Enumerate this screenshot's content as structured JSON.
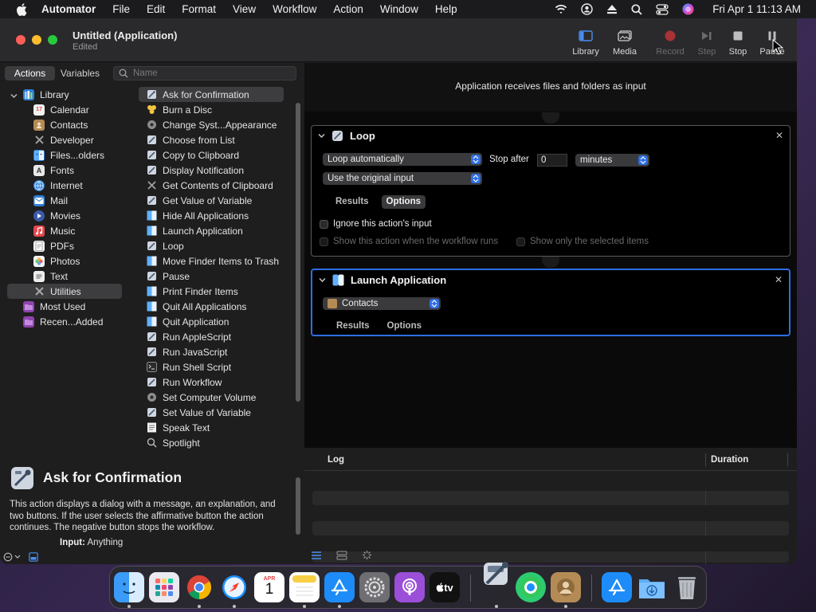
{
  "menubar": {
    "app": "Automator",
    "items": [
      "File",
      "Edit",
      "Format",
      "View",
      "Workflow",
      "Action",
      "Window",
      "Help"
    ],
    "clock": "Fri Apr 1  11:13 AM"
  },
  "window": {
    "title": "Untitled (Application)",
    "subtitle": "Edited",
    "toolbar": {
      "library": "Library",
      "media": "Media",
      "record": "Record",
      "step": "Step",
      "stop": "Stop",
      "pause": "Pause"
    }
  },
  "left": {
    "seg": {
      "actions": "Actions",
      "variables": "Variables"
    },
    "search_placeholder": "Name",
    "library": [
      {
        "label": "Library",
        "icon": "library-icon",
        "color": "#3d8bd9"
      },
      {
        "label": "Calendar",
        "icon": "calendar-icon",
        "color": "#e9e9e9"
      },
      {
        "label": "Contacts",
        "icon": "contacts-icon",
        "color": "#b58b55"
      },
      {
        "label": "Developer",
        "icon": "developer-icon",
        "color": "#8a8a8a"
      },
      {
        "label": "Files...olders",
        "icon": "finder-icon",
        "color": "#3d8bd9"
      },
      {
        "label": "Fonts",
        "icon": "fonts-icon",
        "color": "#cfcfcf"
      },
      {
        "label": "Internet",
        "icon": "internet-icon",
        "color": "#3d8bd9"
      },
      {
        "label": "Mail",
        "icon": "mail-icon",
        "color": "#3d8bd9"
      },
      {
        "label": "Movies",
        "icon": "movies-icon",
        "color": "#4b6cb7"
      },
      {
        "label": "Music",
        "icon": "music-icon",
        "color": "#e5484d"
      },
      {
        "label": "PDFs",
        "icon": "pdf-icon",
        "color": "#d9d9d9"
      },
      {
        "label": "Photos",
        "icon": "photos-icon",
        "color": "#e7a33a"
      },
      {
        "label": "Text",
        "icon": "text-icon",
        "color": "#cfcfcf"
      },
      {
        "label": "Utilities",
        "icon": "utilities-icon",
        "color": "#8a8a8a"
      },
      {
        "label": "Most Used",
        "icon": "most-used-icon",
        "color": "#9b59b6"
      },
      {
        "label": "Recen...Added",
        "icon": "recently-added-icon",
        "color": "#9b59b6"
      }
    ],
    "actions": [
      "Ask for Confirmation",
      "Burn a Disc",
      "Change Syst...Appearance",
      "Choose from List",
      "Copy to Clipboard",
      "Display Notification",
      "Get Contents of Clipboard",
      "Get Value of Variable",
      "Hide All Applications",
      "Launch Application",
      "Loop",
      "Move Finder Items to Trash",
      "Pause",
      "Print Finder Items",
      "Quit All Applications",
      "Quit Application",
      "Run AppleScript",
      "Run JavaScript",
      "Run Shell Script",
      "Run Workflow",
      "Set Computer Volume",
      "Set Value of Variable",
      "Speak Text",
      "Spotlight"
    ],
    "description": {
      "title": "Ask for Confirmation",
      "body": "This action displays a dialog with a message, an explanation, and two buttons. If the user selects the affirmative button the action continues. The negative button stops the workflow.",
      "input_label": "Input:",
      "input_value": "Anything"
    }
  },
  "workflow": {
    "header": "Application receives files and folders as input",
    "loop": {
      "title": "Loop",
      "mode": "Loop automatically",
      "stop_after_label": "Stop after",
      "stop_after_value": "0",
      "unit": "minutes",
      "input_mode": "Use the original input",
      "tab_results": "Results",
      "tab_options": "Options",
      "ignore_input": "Ignore this action's input",
      "show_when_runs": "Show this action when the workflow runs",
      "show_selected": "Show only the selected items"
    },
    "launch": {
      "title": "Launch Application",
      "app": "Contacts",
      "tab_results": "Results",
      "tab_options": "Options"
    }
  },
  "log": {
    "col_log": "Log",
    "col_duration": "Duration"
  },
  "dock": {
    "apps": [
      "Finder",
      "Launchpad",
      "Chrome",
      "Safari",
      "Calendar",
      "Notes",
      "App Store",
      "System Preferences",
      "Podcasts",
      "TV",
      "Automator",
      "Find My",
      "Contacts",
      "App Store 2",
      "Downloads",
      "Trash"
    ],
    "calendar_month": "APR",
    "calendar_day": "1",
    "tv_label": "tv"
  },
  "colors": {
    "accent": "#2f6ee2",
    "record": "#e5484d"
  }
}
